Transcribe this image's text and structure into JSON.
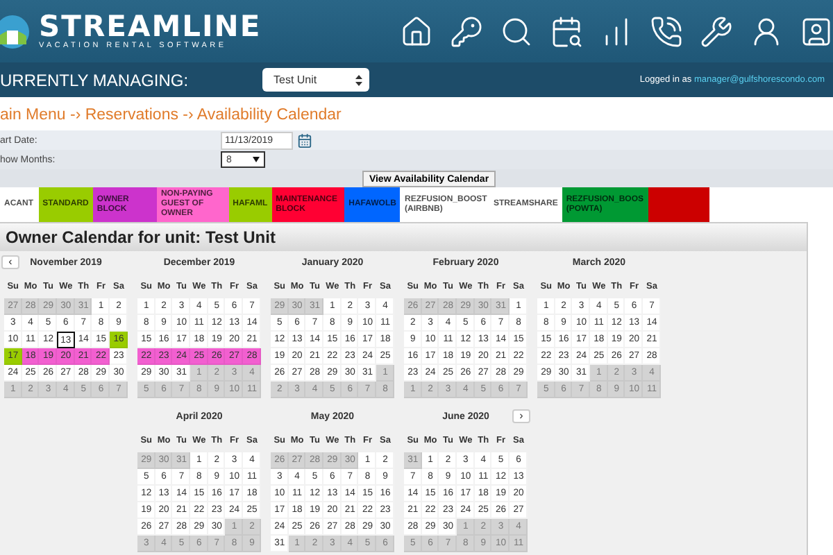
{
  "header": {
    "logo_title": "STREAMLINE",
    "logo_subtitle": "VACATION RENTAL SOFTWARE"
  },
  "managing": {
    "label": "URRENTLY MANAGING:",
    "unit_select": "Test Unit",
    "logged_in_label": "Logged in as",
    "logged_in_user": "manager@gulfshorescondo.com"
  },
  "breadcrumb": "ain Menu -› Reservations -› Availability Calendar",
  "form": {
    "start_date_label": "art Date:",
    "start_date": "11/13/2019",
    "months_label": "how Months:",
    "months": "8",
    "submit": "View Availability Calendar"
  },
  "legend": [
    {
      "label": "ACANT",
      "color": "#ffffff"
    },
    {
      "label": "STANDARD",
      "color": "#99cc00"
    },
    {
      "label": "OWNER BLOCK",
      "color": "#cc33cc"
    },
    {
      "label": "NON-PAYING GUEST OF OWNER",
      "color": "#ff66cc"
    },
    {
      "label": "HAFAML",
      "color": "#99cc00"
    },
    {
      "label": "MAINTENANCE BLOCK",
      "color": "#ff0033"
    },
    {
      "label": "HAFAWOLB",
      "color": "#0066ff"
    },
    {
      "label": "REZFUSION_BOOST (AIRBNB)",
      "color": "#ffffff"
    },
    {
      "label": "STREAMSHARE",
      "color": "#ffffff"
    },
    {
      "label": "REZFUSION_BOOS (POWTA)",
      "color": "#009933"
    },
    {
      "color": "#cc0000"
    }
  ],
  "calendar": {
    "title": "Owner Calendar for unit: Test Unit",
    "prev_button": "‹",
    "next_button": "›",
    "months": [
      {
        "title": "November 2019",
        "weekdays": [
          "Su",
          "Mo",
          "Tu",
          "We",
          "Th",
          "Fr",
          "Sa"
        ],
        "weeks": [
          [
            {
              "d": "27",
              "kind": "other"
            },
            {
              "d": "28",
              "kind": "other"
            },
            {
              "d": "29",
              "kind": "other"
            },
            {
              "d": "30",
              "kind": "other"
            },
            {
              "d": "31",
              "kind": "other"
            },
            {
              "d": "1",
              "kind": "open"
            },
            {
              "d": "2",
              "kind": "open"
            }
          ],
          [
            {
              "d": "3",
              "kind": "open"
            },
            {
              "d": "4",
              "kind": "open"
            },
            {
              "d": "5",
              "kind": "open"
            },
            {
              "d": "6",
              "kind": "open"
            },
            {
              "d": "7",
              "kind": "open"
            },
            {
              "d": "8",
              "kind": "open"
            },
            {
              "d": "9",
              "kind": "open"
            }
          ],
          [
            {
              "d": "10",
              "kind": "open"
            },
            {
              "d": "11",
              "kind": "open"
            },
            {
              "d": "12",
              "kind": "open"
            },
            {
              "d": "13",
              "kind": "today"
            },
            {
              "d": "14",
              "kind": "open"
            },
            {
              "d": "15",
              "kind": "open"
            },
            {
              "d": "16",
              "kind": "standard"
            }
          ],
          [
            {
              "d": "17",
              "kind": "standard"
            },
            {
              "d": "18",
              "kind": "guest"
            },
            {
              "d": "19",
              "kind": "guest"
            },
            {
              "d": "20",
              "kind": "guest"
            },
            {
              "d": "21",
              "kind": "guest"
            },
            {
              "d": "22",
              "kind": "guest"
            },
            {
              "d": "23",
              "kind": "open"
            }
          ],
          [
            {
              "d": "24",
              "kind": "open"
            },
            {
              "d": "25",
              "kind": "open"
            },
            {
              "d": "26",
              "kind": "open"
            },
            {
              "d": "27",
              "kind": "open"
            },
            {
              "d": "28",
              "kind": "open"
            },
            {
              "d": "29",
              "kind": "open"
            },
            {
              "d": "30",
              "kind": "open"
            }
          ],
          [
            {
              "d": "1",
              "kind": "other"
            },
            {
              "d": "2",
              "kind": "other"
            },
            {
              "d": "3",
              "kind": "other"
            },
            {
              "d": "4",
              "kind": "other"
            },
            {
              "d": "5",
              "kind": "other"
            },
            {
              "d": "6",
              "kind": "other"
            },
            {
              "d": "7",
              "kind": "other"
            }
          ]
        ]
      },
      {
        "title": "December 2019",
        "weekdays": [
          "Su",
          "Mo",
          "Tu",
          "We",
          "Th",
          "Fr",
          "Sa"
        ],
        "weeks": [
          [
            {
              "d": "1",
              "kind": "open"
            },
            {
              "d": "2",
              "kind": "open"
            },
            {
              "d": "3",
              "kind": "open"
            },
            {
              "d": "4",
              "kind": "open"
            },
            {
              "d": "5",
              "kind": "open"
            },
            {
              "d": "6",
              "kind": "open"
            },
            {
              "d": "7",
              "kind": "open"
            }
          ],
          [
            {
              "d": "8",
              "kind": "open"
            },
            {
              "d": "9",
              "kind": "open"
            },
            {
              "d": "10",
              "kind": "open"
            },
            {
              "d": "11",
              "kind": "open"
            },
            {
              "d": "12",
              "kind": "open"
            },
            {
              "d": "13",
              "kind": "open"
            },
            {
              "d": "14",
              "kind": "open"
            }
          ],
          [
            {
              "d": "15",
              "kind": "open"
            },
            {
              "d": "16",
              "kind": "open"
            },
            {
              "d": "17",
              "kind": "open"
            },
            {
              "d": "18",
              "kind": "open"
            },
            {
              "d": "19",
              "kind": "open"
            },
            {
              "d": "20",
              "kind": "open"
            },
            {
              "d": "21",
              "kind": "open"
            }
          ],
          [
            {
              "d": "22",
              "kind": "guest"
            },
            {
              "d": "23",
              "kind": "guest"
            },
            {
              "d": "24",
              "kind": "guest"
            },
            {
              "d": "25",
              "kind": "guest"
            },
            {
              "d": "26",
              "kind": "guest"
            },
            {
              "d": "27",
              "kind": "guest"
            },
            {
              "d": "28",
              "kind": "guest"
            }
          ],
          [
            {
              "d": "29",
              "kind": "open"
            },
            {
              "d": "30",
              "kind": "open"
            },
            {
              "d": "31",
              "kind": "open"
            },
            {
              "d": "1",
              "kind": "other"
            },
            {
              "d": "2",
              "kind": "other"
            },
            {
              "d": "3",
              "kind": "other"
            },
            {
              "d": "4",
              "kind": "other"
            }
          ],
          [
            {
              "d": "5",
              "kind": "other"
            },
            {
              "d": "6",
              "kind": "other"
            },
            {
              "d": "7",
              "kind": "other"
            },
            {
              "d": "8",
              "kind": "other"
            },
            {
              "d": "9",
              "kind": "other"
            },
            {
              "d": "10",
              "kind": "other"
            },
            {
              "d": "11",
              "kind": "other"
            }
          ]
        ]
      },
      {
        "title": "January 2020",
        "weekdays": [
          "Su",
          "Mo",
          "Tu",
          "We",
          "Th",
          "Fr",
          "Sa"
        ],
        "weeks": [
          [
            {
              "d": "29",
              "kind": "other"
            },
            {
              "d": "30",
              "kind": "other"
            },
            {
              "d": "31",
              "kind": "other"
            },
            {
              "d": "1",
              "kind": "open"
            },
            {
              "d": "2",
              "kind": "open"
            },
            {
              "d": "3",
              "kind": "open"
            },
            {
              "d": "4",
              "kind": "open"
            }
          ],
          [
            {
              "d": "5",
              "kind": "open"
            },
            {
              "d": "6",
              "kind": "open"
            },
            {
              "d": "7",
              "kind": "open"
            },
            {
              "d": "8",
              "kind": "open"
            },
            {
              "d": "9",
              "kind": "open"
            },
            {
              "d": "10",
              "kind": "open"
            },
            {
              "d": "11",
              "kind": "open"
            }
          ],
          [
            {
              "d": "12",
              "kind": "open"
            },
            {
              "d": "13",
              "kind": "open"
            },
            {
              "d": "14",
              "kind": "open"
            },
            {
              "d": "15",
              "kind": "open"
            },
            {
              "d": "16",
              "kind": "open"
            },
            {
              "d": "17",
              "kind": "open"
            },
            {
              "d": "18",
              "kind": "open"
            }
          ],
          [
            {
              "d": "19",
              "kind": "open"
            },
            {
              "d": "20",
              "kind": "open"
            },
            {
              "d": "21",
              "kind": "open"
            },
            {
              "d": "22",
              "kind": "open"
            },
            {
              "d": "23",
              "kind": "open"
            },
            {
              "d": "24",
              "kind": "open"
            },
            {
              "d": "25",
              "kind": "open"
            }
          ],
          [
            {
              "d": "26",
              "kind": "open"
            },
            {
              "d": "27",
              "kind": "open"
            },
            {
              "d": "28",
              "kind": "open"
            },
            {
              "d": "29",
              "kind": "open"
            },
            {
              "d": "30",
              "kind": "open"
            },
            {
              "d": "31",
              "kind": "open"
            },
            {
              "d": "1",
              "kind": "other"
            }
          ],
          [
            {
              "d": "2",
              "kind": "other"
            },
            {
              "d": "3",
              "kind": "other"
            },
            {
              "d": "4",
              "kind": "other"
            },
            {
              "d": "5",
              "kind": "other"
            },
            {
              "d": "6",
              "kind": "other"
            },
            {
              "d": "7",
              "kind": "other"
            },
            {
              "d": "8",
              "kind": "other"
            }
          ]
        ]
      },
      {
        "title": "February 2020",
        "weekdays": [
          "Su",
          "Mo",
          "Tu",
          "We",
          "Th",
          "Fr",
          "Sa"
        ],
        "weeks": [
          [
            {
              "d": "26",
              "kind": "other"
            },
            {
              "d": "27",
              "kind": "other"
            },
            {
              "d": "28",
              "kind": "other"
            },
            {
              "d": "29",
              "kind": "other"
            },
            {
              "d": "30",
              "kind": "other"
            },
            {
              "d": "31",
              "kind": "other"
            },
            {
              "d": "1",
              "kind": "open"
            }
          ],
          [
            {
              "d": "2",
              "kind": "open"
            },
            {
              "d": "3",
              "kind": "open"
            },
            {
              "d": "4",
              "kind": "open"
            },
            {
              "d": "5",
              "kind": "open"
            },
            {
              "d": "6",
              "kind": "open"
            },
            {
              "d": "7",
              "kind": "open"
            },
            {
              "d": "8",
              "kind": "open"
            }
          ],
          [
            {
              "d": "9",
              "kind": "open"
            },
            {
              "d": "10",
              "kind": "open"
            },
            {
              "d": "11",
              "kind": "open"
            },
            {
              "d": "12",
              "kind": "open"
            },
            {
              "d": "13",
              "kind": "open"
            },
            {
              "d": "14",
              "kind": "open"
            },
            {
              "d": "15",
              "kind": "open"
            }
          ],
          [
            {
              "d": "16",
              "kind": "open"
            },
            {
              "d": "17",
              "kind": "open"
            },
            {
              "d": "18",
              "kind": "open"
            },
            {
              "d": "19",
              "kind": "open"
            },
            {
              "d": "20",
              "kind": "open"
            },
            {
              "d": "21",
              "kind": "open"
            },
            {
              "d": "22",
              "kind": "open"
            }
          ],
          [
            {
              "d": "23",
              "kind": "open"
            },
            {
              "d": "24",
              "kind": "open"
            },
            {
              "d": "25",
              "kind": "open"
            },
            {
              "d": "26",
              "kind": "open"
            },
            {
              "d": "27",
              "kind": "open"
            },
            {
              "d": "28",
              "kind": "open"
            },
            {
              "d": "29",
              "kind": "open"
            }
          ],
          [
            {
              "d": "1",
              "kind": "other"
            },
            {
              "d": "2",
              "kind": "other"
            },
            {
              "d": "3",
              "kind": "other"
            },
            {
              "d": "4",
              "kind": "other"
            },
            {
              "d": "5",
              "kind": "other"
            },
            {
              "d": "6",
              "kind": "other"
            },
            {
              "d": "7",
              "kind": "other"
            }
          ]
        ]
      },
      {
        "title": "March 2020",
        "weekdays": [
          "Su",
          "Mo",
          "Tu",
          "We",
          "Th",
          "Fr",
          "Sa"
        ],
        "weeks": [
          [
            {
              "d": "1",
              "kind": "open"
            },
            {
              "d": "2",
              "kind": "open"
            },
            {
              "d": "3",
              "kind": "open"
            },
            {
              "d": "4",
              "kind": "open"
            },
            {
              "d": "5",
              "kind": "open"
            },
            {
              "d": "6",
              "kind": "open"
            },
            {
              "d": "7",
              "kind": "open"
            }
          ],
          [
            {
              "d": "8",
              "kind": "open"
            },
            {
              "d": "9",
              "kind": "open"
            },
            {
              "d": "10",
              "kind": "open"
            },
            {
              "d": "11",
              "kind": "open"
            },
            {
              "d": "12",
              "kind": "open"
            },
            {
              "d": "13",
              "kind": "open"
            },
            {
              "d": "14",
              "kind": "open"
            }
          ],
          [
            {
              "d": "15",
              "kind": "open"
            },
            {
              "d": "16",
              "kind": "open"
            },
            {
              "d": "17",
              "kind": "open"
            },
            {
              "d": "18",
              "kind": "open"
            },
            {
              "d": "19",
              "kind": "open"
            },
            {
              "d": "20",
              "kind": "open"
            },
            {
              "d": "21",
              "kind": "open"
            }
          ],
          [
            {
              "d": "22",
              "kind": "open"
            },
            {
              "d": "23",
              "kind": "open"
            },
            {
              "d": "24",
              "kind": "open"
            },
            {
              "d": "25",
              "kind": "open"
            },
            {
              "d": "26",
              "kind": "open"
            },
            {
              "d": "27",
              "kind": "open"
            },
            {
              "d": "28",
              "kind": "open"
            }
          ],
          [
            {
              "d": "29",
              "kind": "open"
            },
            {
              "d": "30",
              "kind": "open"
            },
            {
              "d": "31",
              "kind": "open"
            },
            {
              "d": "1",
              "kind": "other"
            },
            {
              "d": "2",
              "kind": "other"
            },
            {
              "d": "3",
              "kind": "other"
            },
            {
              "d": "4",
              "kind": "other"
            }
          ],
          [
            {
              "d": "5",
              "kind": "other"
            },
            {
              "d": "6",
              "kind": "other"
            },
            {
              "d": "7",
              "kind": "other"
            },
            {
              "d": "8",
              "kind": "other"
            },
            {
              "d": "9",
              "kind": "other"
            },
            {
              "d": "10",
              "kind": "other"
            },
            {
              "d": "11",
              "kind": "other"
            }
          ]
        ]
      },
      {
        "title": "April 2020",
        "weekdays": [
          "Su",
          "Mo",
          "Tu",
          "We",
          "Th",
          "Fr",
          "Sa"
        ],
        "weeks": [
          [
            {
              "d": "29",
              "kind": "other"
            },
            {
              "d": "30",
              "kind": "other"
            },
            {
              "d": "31",
              "kind": "other"
            },
            {
              "d": "1",
              "kind": "open"
            },
            {
              "d": "2",
              "kind": "open"
            },
            {
              "d": "3",
              "kind": "open"
            },
            {
              "d": "4",
              "kind": "open"
            }
          ],
          [
            {
              "d": "5",
              "kind": "open"
            },
            {
              "d": "6",
              "kind": "open"
            },
            {
              "d": "7",
              "kind": "open"
            },
            {
              "d": "8",
              "kind": "open"
            },
            {
              "d": "9",
              "kind": "open"
            },
            {
              "d": "10",
              "kind": "open"
            },
            {
              "d": "11",
              "kind": "open"
            }
          ],
          [
            {
              "d": "12",
              "kind": "open"
            },
            {
              "d": "13",
              "kind": "open"
            },
            {
              "d": "14",
              "kind": "open"
            },
            {
              "d": "15",
              "kind": "open"
            },
            {
              "d": "16",
              "kind": "open"
            },
            {
              "d": "17",
              "kind": "open"
            },
            {
              "d": "18",
              "kind": "open"
            }
          ],
          [
            {
              "d": "19",
              "kind": "open"
            },
            {
              "d": "20",
              "kind": "open"
            },
            {
              "d": "21",
              "kind": "open"
            },
            {
              "d": "22",
              "kind": "open"
            },
            {
              "d": "23",
              "kind": "open"
            },
            {
              "d": "24",
              "kind": "open"
            },
            {
              "d": "25",
              "kind": "open"
            }
          ],
          [
            {
              "d": "26",
              "kind": "open"
            },
            {
              "d": "27",
              "kind": "open"
            },
            {
              "d": "28",
              "kind": "open"
            },
            {
              "d": "29",
              "kind": "open"
            },
            {
              "d": "30",
              "kind": "open"
            },
            {
              "d": "1",
              "kind": "other"
            },
            {
              "d": "2",
              "kind": "other"
            }
          ],
          [
            {
              "d": "3",
              "kind": "other"
            },
            {
              "d": "4",
              "kind": "other"
            },
            {
              "d": "5",
              "kind": "other"
            },
            {
              "d": "6",
              "kind": "other"
            },
            {
              "d": "7",
              "kind": "other"
            },
            {
              "d": "8",
              "kind": "other"
            },
            {
              "d": "9",
              "kind": "other"
            }
          ]
        ]
      },
      {
        "title": "May 2020",
        "weekdays": [
          "Su",
          "Mo",
          "Tu",
          "We",
          "Th",
          "Fr",
          "Sa"
        ],
        "weeks": [
          [
            {
              "d": "26",
              "kind": "other"
            },
            {
              "d": "27",
              "kind": "other"
            },
            {
              "d": "28",
              "kind": "other"
            },
            {
              "d": "29",
              "kind": "other"
            },
            {
              "d": "30",
              "kind": "other"
            },
            {
              "d": "1",
              "kind": "open"
            },
            {
              "d": "2",
              "kind": "open"
            }
          ],
          [
            {
              "d": "3",
              "kind": "open"
            },
            {
              "d": "4",
              "kind": "open"
            },
            {
              "d": "5",
              "kind": "open"
            },
            {
              "d": "6",
              "kind": "open"
            },
            {
              "d": "7",
              "kind": "open"
            },
            {
              "d": "8",
              "kind": "open"
            },
            {
              "d": "9",
              "kind": "open"
            }
          ],
          [
            {
              "d": "10",
              "kind": "open"
            },
            {
              "d": "11",
              "kind": "open"
            },
            {
              "d": "12",
              "kind": "open"
            },
            {
              "d": "13",
              "kind": "open"
            },
            {
              "d": "14",
              "kind": "open"
            },
            {
              "d": "15",
              "kind": "open"
            },
            {
              "d": "16",
              "kind": "open"
            }
          ],
          [
            {
              "d": "17",
              "kind": "open"
            },
            {
              "d": "18",
              "kind": "open"
            },
            {
              "d": "19",
              "kind": "open"
            },
            {
              "d": "20",
              "kind": "open"
            },
            {
              "d": "21",
              "kind": "open"
            },
            {
              "d": "22",
              "kind": "open"
            },
            {
              "d": "23",
              "kind": "open"
            }
          ],
          [
            {
              "d": "24",
              "kind": "open"
            },
            {
              "d": "25",
              "kind": "open"
            },
            {
              "d": "26",
              "kind": "open"
            },
            {
              "d": "27",
              "kind": "open"
            },
            {
              "d": "28",
              "kind": "open"
            },
            {
              "d": "29",
              "kind": "open"
            },
            {
              "d": "30",
              "kind": "open"
            }
          ],
          [
            {
              "d": "31",
              "kind": "open"
            },
            {
              "d": "1",
              "kind": "other"
            },
            {
              "d": "2",
              "kind": "other"
            },
            {
              "d": "3",
              "kind": "other"
            },
            {
              "d": "4",
              "kind": "other"
            },
            {
              "d": "5",
              "kind": "other"
            },
            {
              "d": "6",
              "kind": "other"
            }
          ]
        ]
      },
      {
        "title": "June 2020",
        "weekdays": [
          "Su",
          "Mo",
          "Tu",
          "We",
          "Th",
          "Fr",
          "Sa"
        ],
        "weeks": [
          [
            {
              "d": "31",
              "kind": "other"
            },
            {
              "d": "1",
              "kind": "open"
            },
            {
              "d": "2",
              "kind": "open"
            },
            {
              "d": "3",
              "kind": "open"
            },
            {
              "d": "4",
              "kind": "open"
            },
            {
              "d": "5",
              "kind": "open"
            },
            {
              "d": "6",
              "kind": "open"
            }
          ],
          [
            {
              "d": "7",
              "kind": "open"
            },
            {
              "d": "8",
              "kind": "open"
            },
            {
              "d": "9",
              "kind": "open"
            },
            {
              "d": "10",
              "kind": "open"
            },
            {
              "d": "11",
              "kind": "open"
            },
            {
              "d": "12",
              "kind": "open"
            },
            {
              "d": "13",
              "kind": "open"
            }
          ],
          [
            {
              "d": "14",
              "kind": "open"
            },
            {
              "d": "15",
              "kind": "open"
            },
            {
              "d": "16",
              "kind": "open"
            },
            {
              "d": "17",
              "kind": "open"
            },
            {
              "d": "18",
              "kind": "open"
            },
            {
              "d": "19",
              "kind": "open"
            },
            {
              "d": "20",
              "kind": "open"
            }
          ],
          [
            {
              "d": "21",
              "kind": "open"
            },
            {
              "d": "22",
              "kind": "open"
            },
            {
              "d": "23",
              "kind": "open"
            },
            {
              "d": "24",
              "kind": "open"
            },
            {
              "d": "25",
              "kind": "open"
            },
            {
              "d": "26",
              "kind": "open"
            },
            {
              "d": "27",
              "kind": "open"
            }
          ],
          [
            {
              "d": "28",
              "kind": "open"
            },
            {
              "d": "29",
              "kind": "open"
            },
            {
              "d": "30",
              "kind": "open"
            },
            {
              "d": "1",
              "kind": "other"
            },
            {
              "d": "2",
              "kind": "other"
            },
            {
              "d": "3",
              "kind": "other"
            },
            {
              "d": "4",
              "kind": "other"
            }
          ],
          [
            {
              "d": "5",
              "kind": "other"
            },
            {
              "d": "6",
              "kind": "other"
            },
            {
              "d": "7",
              "kind": "other"
            },
            {
              "d": "8",
              "kind": "other"
            },
            {
              "d": "9",
              "kind": "other"
            },
            {
              "d": "10",
              "kind": "other"
            },
            {
              "d": "11",
              "kind": "other"
            }
          ]
        ]
      }
    ]
  }
}
